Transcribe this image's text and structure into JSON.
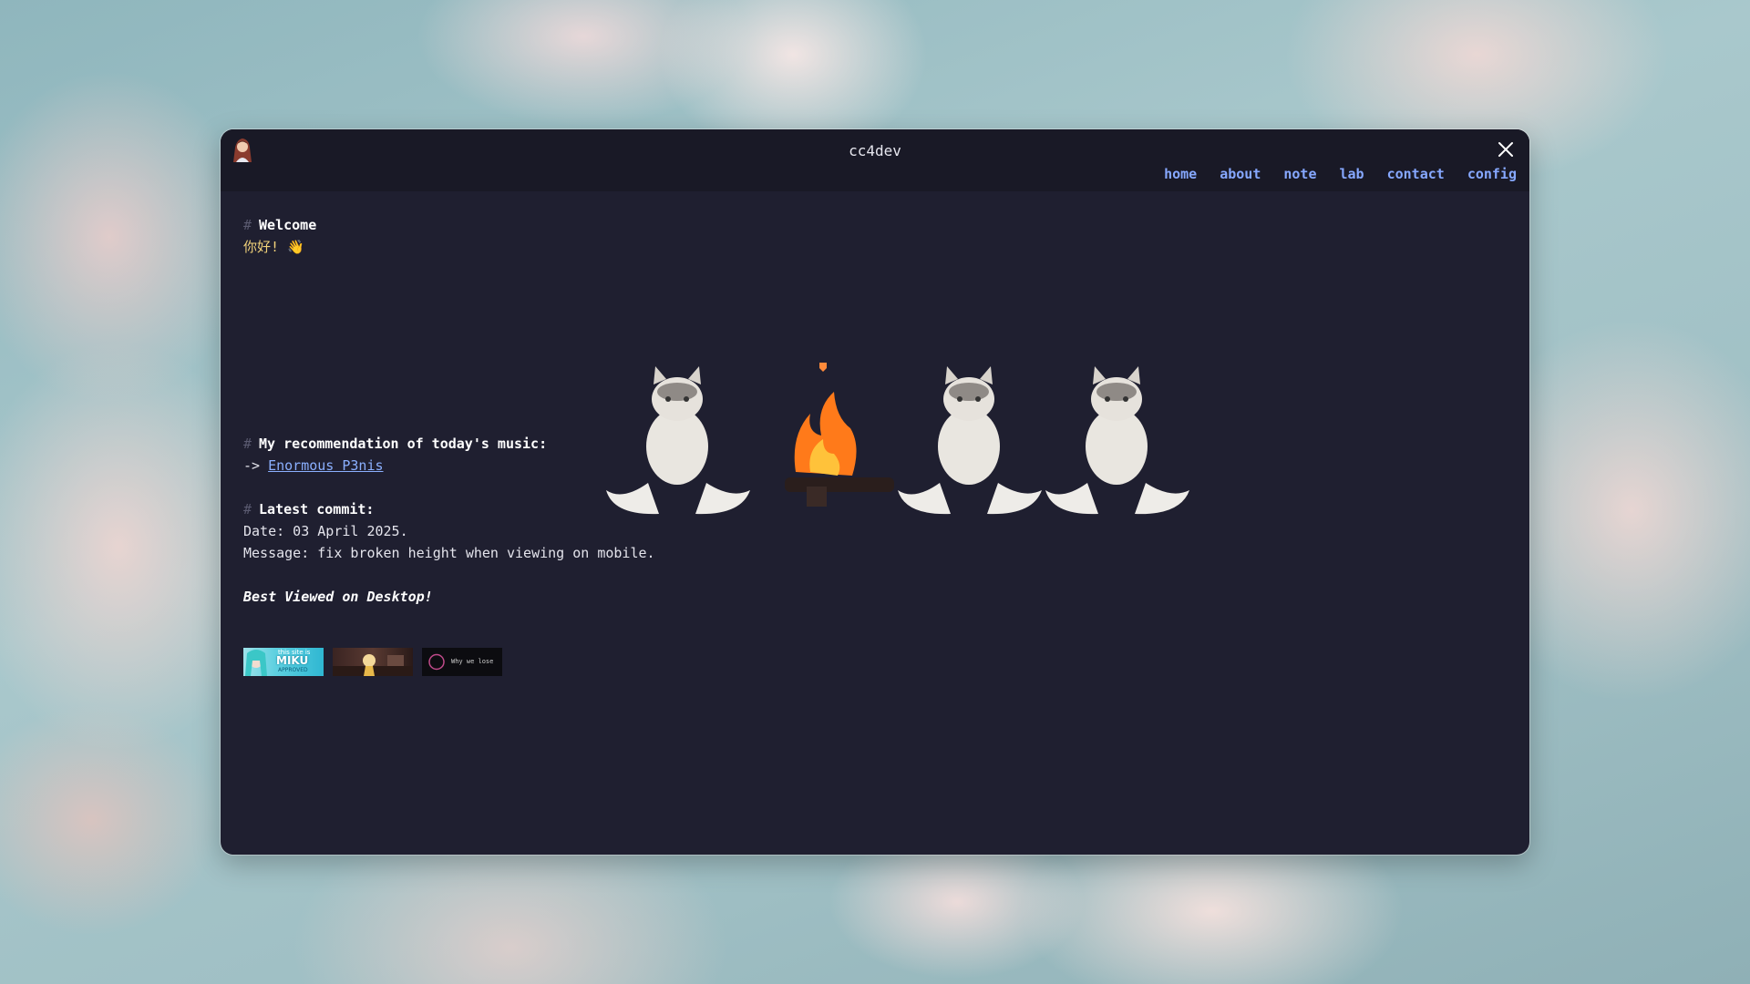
{
  "window": {
    "title": "cc4dev"
  },
  "nav": {
    "items": [
      "home",
      "about",
      "note",
      "lab",
      "contact",
      "config"
    ]
  },
  "content": {
    "welcome_heading": "Welcome",
    "greeting": "你好! 👋",
    "music_heading": "My recommendation of today's music:",
    "music_arrow": "->",
    "music_link": "Enormous P3nis",
    "commit_heading": "Latest commit:",
    "commit_date": "Date: 03 April 2025.",
    "commit_message": "Message: fix broken height when viewing on mobile.",
    "tagline": "Best Viewed on Desktop!"
  },
  "badges": {
    "miku_line1": "this site is",
    "miku_line2": "MIKU",
    "miku_line3": "APPROVED",
    "why_we_lose": "Why we lose"
  },
  "colors": {
    "window_bg": "#1f1f30",
    "titlebar_bg": "#191926",
    "nav_link": "#86a8ff",
    "greeting": "#f1d27a"
  },
  "icons": [
    "avatar-icon",
    "close-icon",
    "wave-hand-emoji"
  ]
}
